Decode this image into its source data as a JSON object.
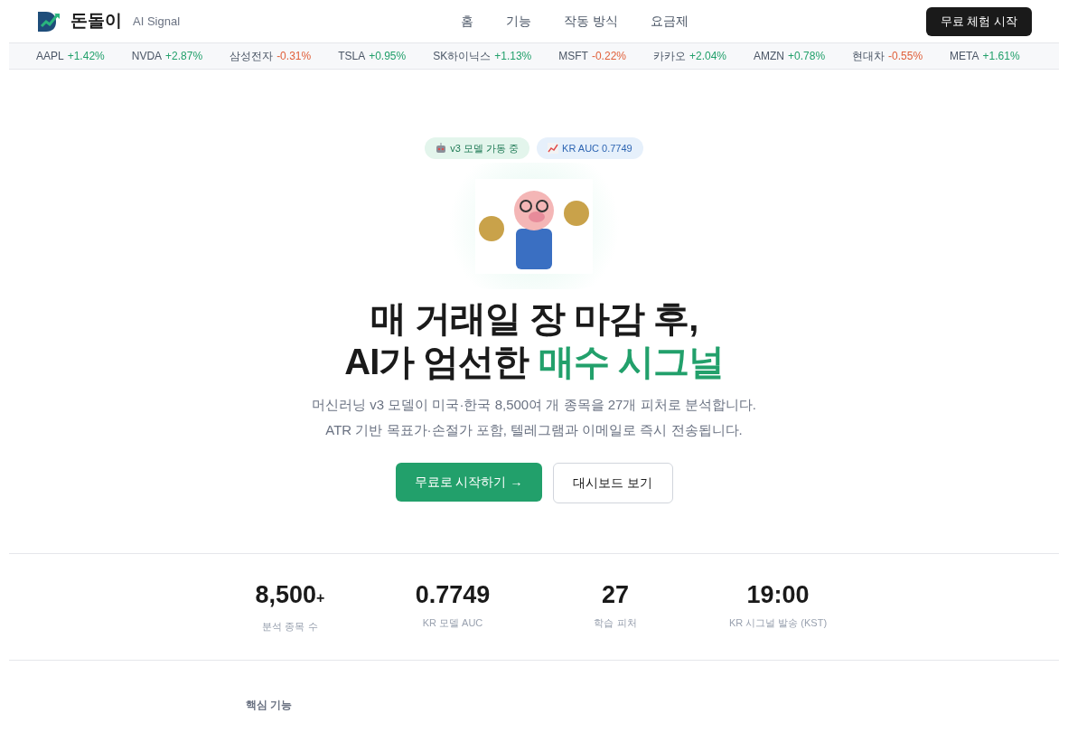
{
  "nav": {
    "brand": "돈돌이",
    "tagline": "AI Signal",
    "links": [
      "홈",
      "기능",
      "작동 방식",
      "요금제"
    ],
    "cta": "무료 체험 시작"
  },
  "ticker": [
    {
      "symbol": "AAPL",
      "change": "+1.42%",
      "color": "#22a06b"
    },
    {
      "symbol": "NVDA",
      "change": "+2.87%",
      "color": "#22a06b"
    },
    {
      "symbol": "삼성전자",
      "change": "-0.31%",
      "color": "#e0603a"
    },
    {
      "symbol": "TSLA",
      "change": "+0.95%",
      "color": "#22a06b"
    },
    {
      "symbol": "SK하이닉스",
      "change": "+1.13%",
      "color": "#22a06b"
    },
    {
      "symbol": "MSFT",
      "change": "-0.22%",
      "color": "#e0603a"
    },
    {
      "symbol": "카카오",
      "change": "+2.04%",
      "color": "#22a06b"
    },
    {
      "symbol": "AMZN",
      "change": "+0.78%",
      "color": "#22a06b"
    },
    {
      "symbol": "현대차",
      "change": "-0.55%",
      "color": "#e0603a"
    },
    {
      "symbol": "META",
      "change": "+1.61%",
      "color": "#22a06b"
    }
  ],
  "hero": {
    "badges": [
      {
        "kind": "robot",
        "text": "v3 모델 가동 중"
      },
      {
        "kind": "chart",
        "text": "KR AUC 0.7749"
      }
    ],
    "headline_line1": "매 거래일 장 마감 후,",
    "headline_line2": "AI가 엄선한 ",
    "headline_highlight": "매수 시그널",
    "description": [
      "머신러닝 v3 모델이 미국·한국 8,500여 개 종목을 27개 피처로 분석합니다.",
      "ATR 기반 목표가·손절가 포함, 텔레그램과 이메일로 즉시 전송됩니다."
    ],
    "primary_button": "무료로 시작하기 →",
    "secondary_button": "대시보드 보기"
  },
  "stats": [
    {
      "value": "8,500",
      "suffix": "+",
      "label": "분석 종목 수"
    },
    {
      "value": "0.7749",
      "label": "KR 모델 AUC"
    },
    {
      "value": "27",
      "label": "학습 피처"
    },
    {
      "value": "19:00",
      "label": "KR 시그널 발송 (KST)"
    }
  ],
  "next_section": {
    "eyebrow": "핵심 기능"
  }
}
